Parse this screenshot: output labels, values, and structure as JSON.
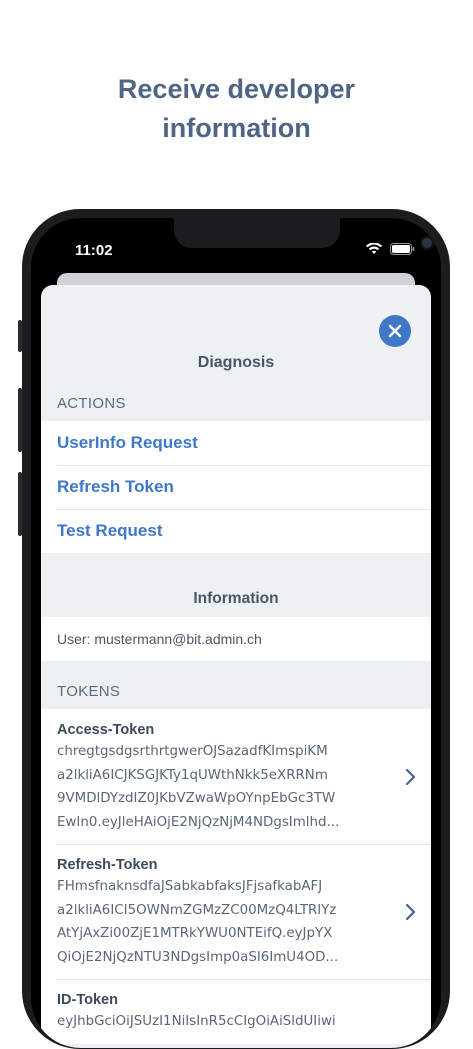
{
  "headline": {
    "line1": "Receive developer",
    "line2": "information"
  },
  "status_bar": {
    "time": "11:02"
  },
  "sheet": {
    "title": "Diagnosis",
    "close_icon": "close-icon",
    "actions_section": {
      "label": "ACTIONS",
      "items": [
        "UserInfo Request",
        "Refresh Token",
        "Test Request"
      ]
    },
    "information_section": {
      "title": "Information",
      "user": "User: mustermann@bit.admin.ch"
    },
    "tokens_section": {
      "label": "TOKENS",
      "items": [
        {
          "label": "Access-Token",
          "lines": [
            "chregtgsdgsrthrtgwerOJSazadfKImspiKM",
            "a2lkliA6ICJKSGJKTy1qUWthNkk5eXRRNm",
            "9VMDlDYzdIZ0JKbVZwaWpOYnpEbGc3TW",
            "EwIn0.eyJleHAiOjE2NjQzNjM4NDgsImlhd..."
          ]
        },
        {
          "label": "Refresh-Token",
          "lines": [
            "FHmsfnaknsdfaJSabkabfaksJFjsafkabAFJ",
            "a2lkliA6ICI5OWNmZGMzZC00MzQ4LTRlYz",
            "AtYjAxZi00ZjE1MTRkYWU0NTEifQ.eyJpYX",
            "QiOjE2NjQzNTU3NDgsImp0aSI6ImU4OD..."
          ]
        },
        {
          "label": "ID-Token",
          "lines": [
            "eyJhbGciOiJSUzI1NiIsInR5cCIgOiAiSldUIiwi"
          ]
        }
      ]
    }
  },
  "colors": {
    "accent": "#3f78c9",
    "headline": "#4f6584",
    "sheet_background": "#eef1f4"
  }
}
